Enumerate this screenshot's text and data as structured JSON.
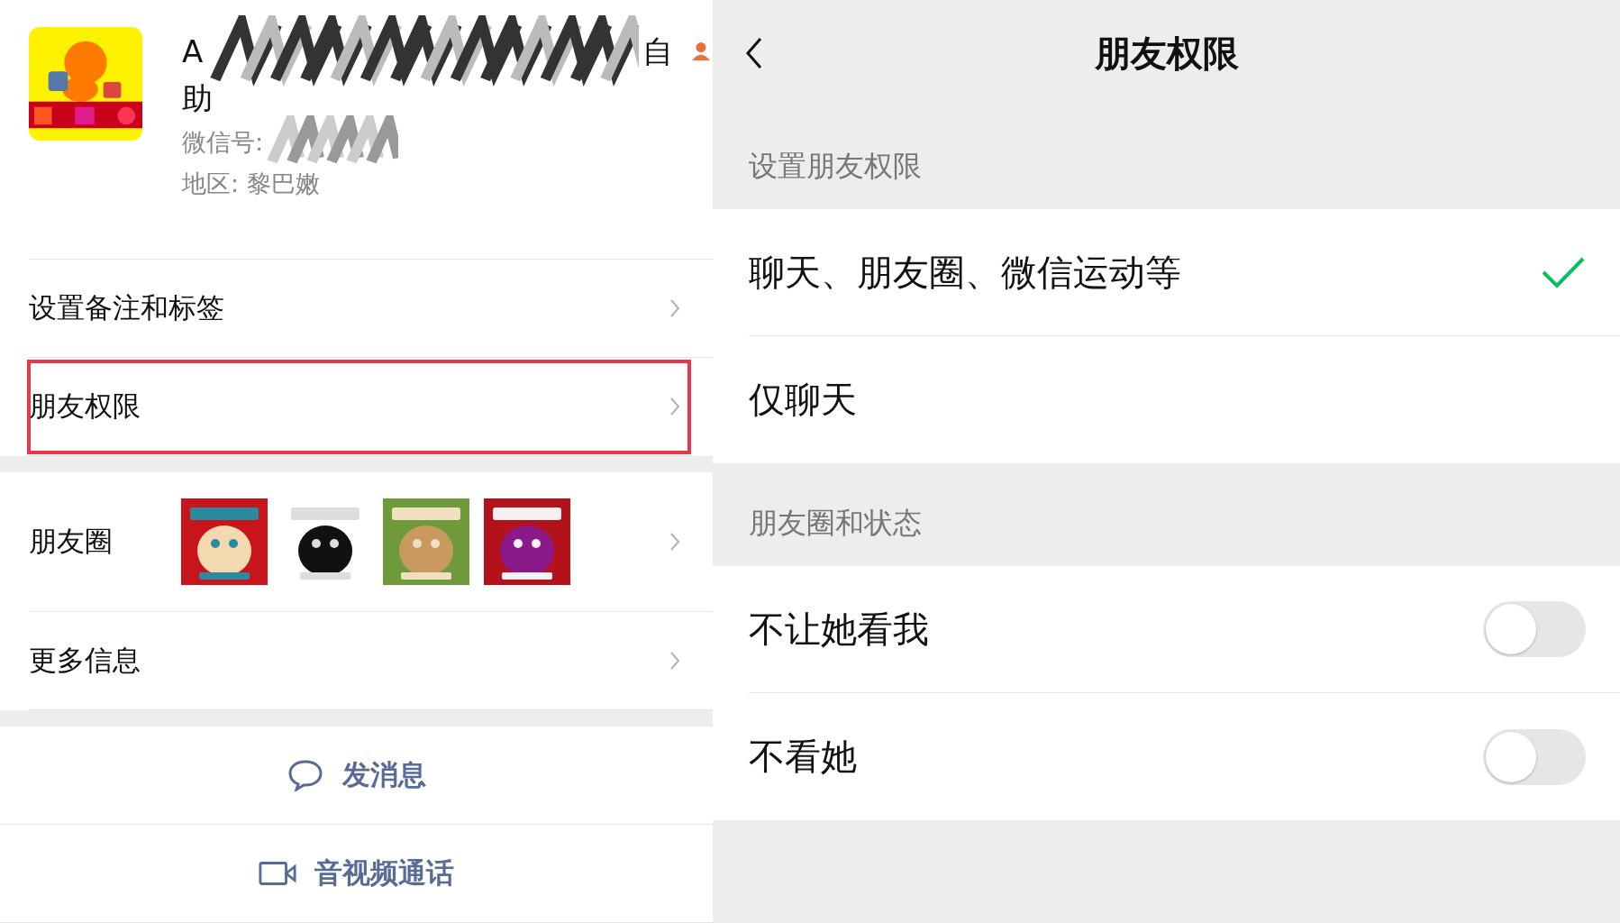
{
  "profile": {
    "name_start": "A",
    "name_end": "自",
    "name_wrap": "助",
    "wechat_id_label": "微信号:",
    "region": "地区:  黎巴嫩"
  },
  "menu": [
    {
      "label": "设置备注和标签",
      "highlighted": false
    },
    {
      "label": "朋友权限",
      "highlighted": true
    }
  ],
  "moments": {
    "label": "朋友圈"
  },
  "more_info": {
    "label": "更多信息"
  },
  "actions": [
    {
      "kind": "message",
      "label": "发消息"
    },
    {
      "kind": "video",
      "label": "音视频通话"
    }
  ],
  "permissions": {
    "title": "朋友权限",
    "section1": "设置朋友权限",
    "options": [
      {
        "label": "聊天、朋友圈、微信运动等",
        "selected": true
      },
      {
        "label": "仅聊天",
        "selected": false
      }
    ],
    "section2": "朋友圈和状态",
    "toggles": [
      {
        "label": "不让她看我",
        "on": false
      },
      {
        "label": "不看她",
        "on": false
      }
    ]
  }
}
